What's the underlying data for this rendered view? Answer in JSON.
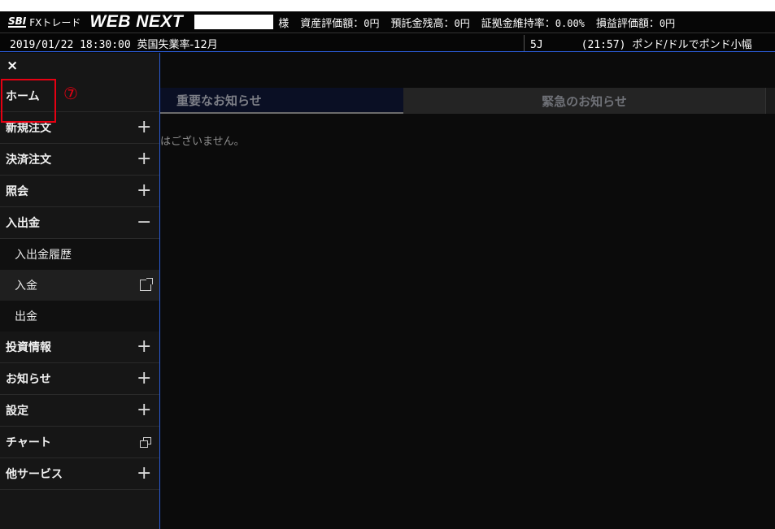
{
  "header": {
    "logo_sbi": "SBI",
    "logo_fx": "FXトレード",
    "logo_web": "WEB NEXT",
    "honorific": "様",
    "items": [
      {
        "label": "資産評価額：",
        "value": "0円"
      },
      {
        "label": "預託金残高：",
        "value": "0円"
      },
      {
        "label": "証拠金維持率：",
        "value": "0.00%"
      },
      {
        "label": "損益評価額：",
        "value": "0円"
      }
    ]
  },
  "ticker": {
    "datetime": "2019/01/22 18:30:00 ",
    "event": "英国失業率-12月",
    "news_prefix": "5J",
    "news_time": "(21:57) ",
    "news_text": "ポンド/ドルでポンド小幅"
  },
  "sidebar": {
    "close_glyph": "×",
    "items": [
      {
        "label": "ホーム",
        "icon": ""
      },
      {
        "label": "新規注文",
        "icon": "plus-icon"
      },
      {
        "label": "決済注文",
        "icon": "plus-icon"
      },
      {
        "label": "照会",
        "icon": "plus-icon"
      },
      {
        "label": "入出金",
        "icon": "minus-icon"
      }
    ],
    "subitems": [
      {
        "label": "入出金履歴"
      },
      {
        "label": "入金",
        "icon": "external-link-icon"
      },
      {
        "label": "出金"
      }
    ],
    "items2": [
      {
        "label": "投資情報",
        "icon": "plus-icon"
      },
      {
        "label": "お知らせ",
        "icon": "plus-icon"
      },
      {
        "label": "設定",
        "icon": "plus-icon"
      },
      {
        "label": "チャート",
        "icon": "new-window-icon"
      },
      {
        "label": "他サービス",
        "icon": "plus-icon"
      }
    ]
  },
  "main": {
    "tabs": [
      {
        "label": "重要なお知らせ"
      },
      {
        "label": "緊急のお知らせ"
      }
    ],
    "empty_message": "はございません。"
  },
  "annotation": {
    "number": "⑦",
    "color": "#e60012"
  }
}
